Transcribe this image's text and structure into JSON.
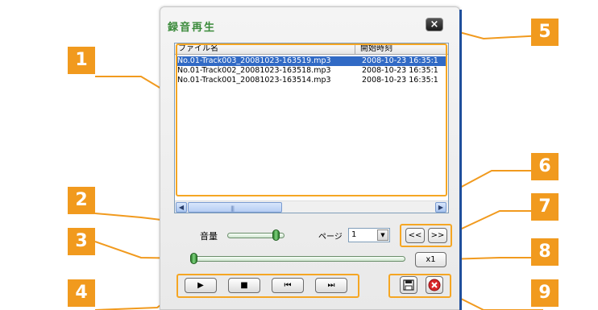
{
  "dialog": {
    "title": "録音再生",
    "close_symbol": "×"
  },
  "list": {
    "columns": [
      "ファイル名",
      "開始時刻"
    ],
    "rows": [
      {
        "file": "No.01-Track003_20081023-163519.mp3",
        "time": "2008-10-23 16:35:1",
        "selected": true
      },
      {
        "file": "No.01-Track002_20081023-163518.mp3",
        "time": "2008-10-23 16:35:1",
        "selected": false
      },
      {
        "file": "No.01-Track001_20081023-163514.mp3",
        "time": "2008-10-23 16:35:1",
        "selected": false
      }
    ],
    "scroll_left_icon": "◀",
    "scroll_right_icon": "▶",
    "scroll_grip": "|||"
  },
  "volume": {
    "label": "音量",
    "level": 0.9
  },
  "page": {
    "label": "ページ",
    "value": "1",
    "dropdown_icon": "▼",
    "prev_label": "<<",
    "next_label": ">>"
  },
  "position": {
    "level": 0.0
  },
  "speed": {
    "label": "x1"
  },
  "controls": {
    "play_symbol": "▶",
    "stop_symbol": "■",
    "prev_symbol": "⏮",
    "next_symbol": "⏭"
  },
  "callouts": [
    "1",
    "2",
    "3",
    "4",
    "5",
    "6",
    "7",
    "8",
    "9"
  ],
  "colors": {
    "accent_orange": "#f19a1e",
    "title_green": "#3a8a3a",
    "selection_blue": "#316ac5"
  }
}
